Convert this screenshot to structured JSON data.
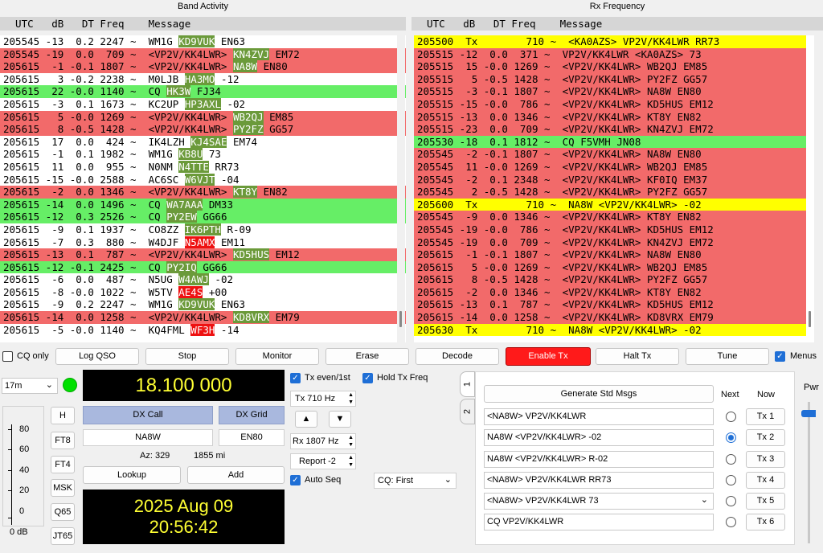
{
  "band_activity": {
    "title": "Band Activity",
    "header": "  UTC   dB   DT Freq    Message",
    "rows": [
      {
        "prefix": "205545 -13  0.2 2247 ~  WM1G ",
        "call": "KD9VUK",
        "suffix": " EN63",
        "bg": "w",
        "hl": "hl"
      },
      {
        "prefix": "205545 -19  0.0  709 ~  <VP2V/KK4LWR> ",
        "call": "KN4ZVJ",
        "suffix": " EM72",
        "bg": "r",
        "hl": "hl"
      },
      {
        "prefix": "205615  -1 -0.1 1807 ~  <VP2V/KK4LWR> ",
        "call": "NA8W",
        "suffix": " EN80",
        "bg": "r",
        "hl": "hl"
      },
      {
        "prefix": "205615   3 -0.2 2238 ~  M0LJB ",
        "call": "HA3MO",
        "suffix": " -12",
        "bg": "w",
        "hl": "hl"
      },
      {
        "prefix": "205615  22 -0.0 1140 ~  CQ ",
        "call": "HK3W",
        "suffix": " FJ34",
        "bg": "g",
        "hl": "hl"
      },
      {
        "prefix": "205615  -3  0.1 1673 ~  KC2UP ",
        "call": "HP3AXL",
        "suffix": " -02",
        "bg": "w",
        "hl": "hl"
      },
      {
        "prefix": "205615   5 -0.0 1269 ~  <VP2V/KK4LWR> ",
        "call": "WB2QJ",
        "suffix": " EM85",
        "bg": "r",
        "hl": "hl"
      },
      {
        "prefix": "205615   8 -0.5 1428 ~  <VP2V/KK4LWR> ",
        "call": "PY2FZ",
        "suffix": " GG57",
        "bg": "r",
        "hl": "hl"
      },
      {
        "prefix": "205615  17  0.0  424 ~  IK4LZH ",
        "call": "KJ4SAE",
        "suffix": " EM74",
        "bg": "w",
        "hl": "hl"
      },
      {
        "prefix": "205615  -1  0.1 1982 ~  WM1G ",
        "call": "KB8U",
        "suffix": " 73",
        "bg": "w",
        "hl": "hl"
      },
      {
        "prefix": "205615  11  0.0  955 ~  N0NM ",
        "call": "N4TTE",
        "suffix": " RR73",
        "bg": "w",
        "hl": "hl"
      },
      {
        "prefix": "205615 -15 -0.0 2588 ~  AC6SC ",
        "call": "W6VJT",
        "suffix": " -04",
        "bg": "w",
        "hl": "hl"
      },
      {
        "prefix": "205615  -2  0.0 1346 ~  <VP2V/KK4LWR> ",
        "call": "KT8Y",
        "suffix": " EN82",
        "bg": "r",
        "hl": "hl"
      },
      {
        "prefix": "205615 -14  0.0 1496 ~  CQ ",
        "call": "WA7AAA",
        "suffix": " DM33",
        "bg": "g",
        "hl": "hl"
      },
      {
        "prefix": "205615 -12  0.3 2526 ~  CQ ",
        "call": "PY2EW",
        "suffix": " GG66",
        "bg": "g",
        "hl": "hl"
      },
      {
        "prefix": "205615  -9  0.1 1937 ~  CO8ZZ ",
        "call": "IK6PTH",
        "suffix": " R-09",
        "bg": "w",
        "hl": "hl"
      },
      {
        "prefix": "205615  -7  0.3  880 ~  W4DJF ",
        "call": "N5AMX",
        "suffix": " EM11",
        "bg": "w",
        "hl": "hr"
      },
      {
        "prefix": "205615 -13  0.1  787 ~  <VP2V/KK4LWR> ",
        "call": "KD5HUS",
        "suffix": " EM12",
        "bg": "r",
        "hl": "hl"
      },
      {
        "prefix": "205615 -12 -0.1 2425 ~  CQ ",
        "call": "PY2IQ",
        "suffix": " GG66",
        "bg": "g",
        "hl": "hl"
      },
      {
        "prefix": "205615  -6  0.0  487 ~  N5UG ",
        "call": "W4AWJ",
        "suffix": " -02",
        "bg": "w",
        "hl": "hl"
      },
      {
        "prefix": "205615  -8 -0.0 1022 ~  W5TV ",
        "call": "AE4S",
        "suffix": " +00",
        "bg": "w",
        "hl": "hr"
      },
      {
        "prefix": "205615  -9  0.2 2247 ~  WM1G ",
        "call": "KD9VUK",
        "suffix": " EN63",
        "bg": "w",
        "hl": "hl"
      },
      {
        "prefix": "205615 -14  0.0 1258 ~  <VP2V/KK4LWR> ",
        "call": "KD8VRX",
        "suffix": " EM79",
        "bg": "r",
        "hl": "hl"
      },
      {
        "prefix": "205615  -5 -0.0 1140 ~  KQ4FML ",
        "call": "WF3H",
        "suffix": " -14",
        "bg": "w",
        "hl": "hr"
      }
    ]
  },
  "rx_frequency": {
    "title": "Rx Frequency",
    "header": "  UTC   dB   DT Freq    Message",
    "rows": [
      {
        "text": "205500  Tx        710 ~  <KA0AZS> VP2V/KK4LWR RR73",
        "bg": "y"
      },
      {
        "text": "205515 -12  0.0  371 ~  VP2V/KK4LWR <KA0AZS> 73",
        "bg": "r"
      },
      {
        "text": "205515  15 -0.0 1269 ~  <VP2V/KK4LWR> WB2QJ EM85",
        "bg": "r"
      },
      {
        "text": "205515   5 -0.5 1428 ~  <VP2V/KK4LWR> PY2FZ GG57",
        "bg": "r"
      },
      {
        "text": "205515  -3 -0.1 1807 ~  <VP2V/KK4LWR> NA8W EN80",
        "bg": "r"
      },
      {
        "text": "205515 -15 -0.0  786 ~  <VP2V/KK4LWR> KD5HUS EM12",
        "bg": "r"
      },
      {
        "text": "205515 -13  0.0 1346 ~  <VP2V/KK4LWR> KT8Y EN82",
        "bg": "r"
      },
      {
        "text": "205515 -23  0.0  709 ~  <VP2V/KK4LWR> KN4ZVJ EM72",
        "bg": "r"
      },
      {
        "text": "205530 -18  0.1 1812 ~  CQ F5VMH JN08",
        "bg": "g"
      },
      {
        "text": "205545  -2 -0.1 1807 ~  <VP2V/KK4LWR> NA8W EN80",
        "bg": "r"
      },
      {
        "text": "205545  11 -0.0 1269 ~  <VP2V/KK4LWR> WB2QJ EM85",
        "bg": "r"
      },
      {
        "text": "205545  -2  0.1 2348 ~  <VP2V/KK4LWR> KF0IQ EM37",
        "bg": "r"
      },
      {
        "text": "205545   2 -0.5 1428 ~  <VP2V/KK4LWR> PY2FZ GG57",
        "bg": "r"
      },
      {
        "text": "205600  Tx        710 ~  NA8W <VP2V/KK4LWR> -02",
        "bg": "y"
      },
      {
        "text": "205545  -9  0.0 1346 ~  <VP2V/KK4LWR> KT8Y EN82",
        "bg": "r"
      },
      {
        "text": "205545 -19 -0.0  786 ~  <VP2V/KK4LWR> KD5HUS EM12",
        "bg": "r"
      },
      {
        "text": "205545 -19  0.0  709 ~  <VP2V/KK4LWR> KN4ZVJ EM72",
        "bg": "r"
      },
      {
        "text": "205615  -1 -0.1 1807 ~  <VP2V/KK4LWR> NA8W EN80",
        "bg": "r"
      },
      {
        "text": "205615   5 -0.0 1269 ~  <VP2V/KK4LWR> WB2QJ EM85",
        "bg": "r"
      },
      {
        "text": "205615   8 -0.5 1428 ~  <VP2V/KK4LWR> PY2FZ GG57",
        "bg": "r"
      },
      {
        "text": "205615  -2  0.0 1346 ~  <VP2V/KK4LWR> KT8Y EN82",
        "bg": "r"
      },
      {
        "text": "205615 -13  0.1  787 ~  <VP2V/KK4LWR> KD5HUS EM12",
        "bg": "r"
      },
      {
        "text": "205615 -14  0.0 1258 ~  <VP2V/KK4LWR> KD8VRX EM79",
        "bg": "r"
      },
      {
        "text": "205630  Tx        710 ~  NA8W <VP2V/KK4LWR> -02",
        "bg": "y"
      }
    ]
  },
  "toolbar": {
    "cq_only": "CQ only",
    "log_qso": "Log QSO",
    "stop": "Stop",
    "monitor": "Monitor",
    "erase": "Erase",
    "decode": "Decode",
    "enable_tx": "Enable Tx",
    "halt_tx": "Halt Tx",
    "tune": "Tune",
    "menus": "Menus"
  },
  "left": {
    "band": "17m",
    "band_arrow": "⌄",
    "freq": "18.100 000",
    "meter_ticks": [
      "80",
      "60",
      "40",
      "20",
      "0"
    ],
    "meter_unit": "0 dB",
    "modes": [
      "H",
      "FT8",
      "FT4",
      "MSK",
      "Q65",
      "JT65"
    ],
    "dx_call_label": "DX Call",
    "dx_grid_label": "DX Grid",
    "dx_call": "NA8W",
    "dx_grid": "EN80",
    "az": "Az: 329",
    "dist": "1855 mi",
    "lookup": "Lookup",
    "add": "Add",
    "date": "2025 Aug 09",
    "time": "20:56:42"
  },
  "mid": {
    "tx_even": "Tx even/1st",
    "hold_tx": "Hold Tx Freq",
    "tx_label": "Tx",
    "tx_value": "710",
    "tx_unit": "Hz",
    "up": "▲",
    "down": "▼",
    "rx_label": "Rx",
    "rx_value": "1807",
    "rx_unit": "Hz",
    "report_label": "Report",
    "report_value": "-2",
    "auto_seq": "Auto Seq",
    "cq_select": "CQ: First"
  },
  "right": {
    "tab1": "1",
    "tab2": "2",
    "gen_std": "Generate Std Msgs",
    "next": "Next",
    "now": "Now",
    "pwr": "Pwr",
    "messages": [
      "<NA8W> VP2V/KK4LWR",
      "NA8W <VP2V/KK4LWR> -02",
      "NA8W <VP2V/KK4LWR> R-02",
      "<NA8W> VP2V/KK4LWR RR73",
      "<NA8W> VP2V/KK4LWR 73",
      "CQ VP2V/KK4LWR"
    ],
    "tx_buttons": [
      "Tx 1",
      "Tx 2",
      "Tx 3",
      "Tx 4",
      "Tx 5",
      "Tx 6"
    ],
    "selected_next": 2
  }
}
